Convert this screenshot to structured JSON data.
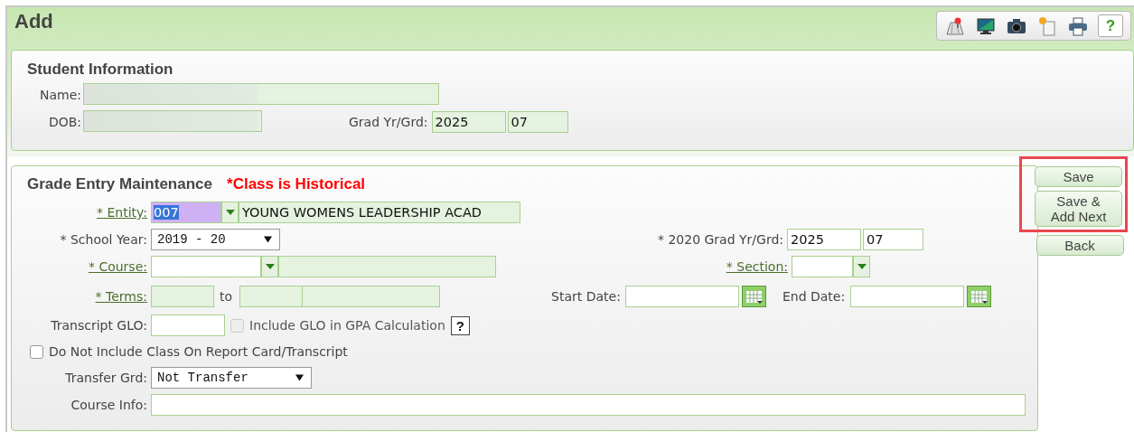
{
  "window": {
    "title": "Add"
  },
  "toolbar": {
    "help_label": "?"
  },
  "student": {
    "title": "Student Information",
    "name_label": "Name:",
    "dob_label": "DOB:",
    "grad_label": "Grad Yr/Grd:",
    "grad_year": "2025",
    "grade": "07"
  },
  "grade_entry": {
    "title": "Grade Entry Maintenance",
    "notice": "*Class is Historical",
    "entity": {
      "label": "* Entity:",
      "code": "007",
      "name": "YOUNG WOMENS LEADERSHIP ACAD"
    },
    "school_year": {
      "label": "* School Year:",
      "value": "2019 - 20"
    },
    "grad": {
      "label": "* 2020 Grad Yr/Grd:",
      "year": "2025",
      "grade": "07"
    },
    "course": {
      "label": "* Course:"
    },
    "section": {
      "label": "* Section:"
    },
    "terms": {
      "label": "* Terms:",
      "to": "to"
    },
    "start_date": {
      "label": "Start Date:"
    },
    "end_date": {
      "label": "End Date:"
    },
    "glo": {
      "label": "Transcript GLO:"
    },
    "checkboxes": [
      {
        "label": "Include GLO in GPA Calculation",
        "checked": false,
        "disabled": true
      },
      {
        "label": "Do Not Include Class On Report Card/Transcript",
        "checked": false,
        "disabled": false
      }
    ],
    "glo_help": "?",
    "transfer": {
      "label": "Transfer Grd:",
      "value": "Not Transfer"
    },
    "course_info": {
      "label": "Course Info:"
    }
  },
  "buttons": [
    {
      "label": "Save",
      "highlighted": true
    },
    {
      "label": "Save &\nAdd Next",
      "highlighted": true
    },
    {
      "label": "Back",
      "highlighted": false
    }
  ]
}
